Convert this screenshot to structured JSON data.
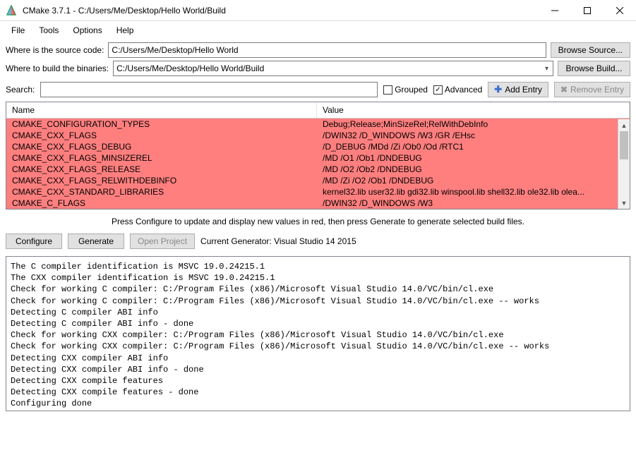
{
  "window": {
    "title": "CMake 3.7.1 - C:/Users/Me/Desktop/Hello World/Build"
  },
  "menu": {
    "file": "File",
    "tools": "Tools",
    "options": "Options",
    "help": "Help"
  },
  "paths": {
    "source_label": "Where is the source code:",
    "source_value": "C:/Users/Me/Desktop/Hello World",
    "browse_source": "Browse Source...",
    "build_label": "Where to build the binaries:",
    "build_value": "C:/Users/Me/Desktop/Hello World/Build",
    "browse_build": "Browse Build..."
  },
  "search": {
    "label": "Search:",
    "value": "",
    "grouped_label": "Grouped",
    "grouped_checked": false,
    "advanced_label": "Advanced",
    "advanced_checked": true,
    "add_entry": "Add Entry",
    "remove_entry": "Remove Entry"
  },
  "table": {
    "col_name": "Name",
    "col_value": "Value",
    "rows": [
      {
        "name": "CMAKE_CONFIGURATION_TYPES",
        "value": "Debug;Release;MinSizeRel;RelWithDebInfo"
      },
      {
        "name": "CMAKE_CXX_FLAGS",
        "value": "/DWIN32 /D_WINDOWS /W3 /GR /EHsc"
      },
      {
        "name": "CMAKE_CXX_FLAGS_DEBUG",
        "value": "/D_DEBUG /MDd /Zi /Ob0 /Od /RTC1"
      },
      {
        "name": "CMAKE_CXX_FLAGS_MINSIZEREL",
        "value": "/MD /O1 /Ob1 /DNDEBUG"
      },
      {
        "name": "CMAKE_CXX_FLAGS_RELEASE",
        "value": "/MD /O2 /Ob2 /DNDEBUG"
      },
      {
        "name": "CMAKE_CXX_FLAGS_RELWITHDEBINFO",
        "value": "/MD /Zi /O2 /Ob1 /DNDEBUG"
      },
      {
        "name": "CMAKE_CXX_STANDARD_LIBRARIES",
        "value": "kernel32.lib user32.lib gdi32.lib winspool.lib shell32.lib ole32.lib olea..."
      },
      {
        "name": "CMAKE_C_FLAGS",
        "value": "/DWIN32 /D_WINDOWS /W3"
      }
    ]
  },
  "hint": "Press Configure to update and display new values in red, then press Generate to generate selected build files.",
  "buttons": {
    "configure": "Configure",
    "generate": "Generate",
    "open_project": "Open Project",
    "generator": "Current Generator: Visual Studio 14 2015"
  },
  "output_lines": [
    "The C compiler identification is MSVC 19.0.24215.1",
    "The CXX compiler identification is MSVC 19.0.24215.1",
    "Check for working C compiler: C:/Program Files (x86)/Microsoft Visual Studio 14.0/VC/bin/cl.exe",
    "Check for working C compiler: C:/Program Files (x86)/Microsoft Visual Studio 14.0/VC/bin/cl.exe -- works",
    "Detecting C compiler ABI info",
    "Detecting C compiler ABI info - done",
    "Check for working CXX compiler: C:/Program Files (x86)/Microsoft Visual Studio 14.0/VC/bin/cl.exe",
    "Check for working CXX compiler: C:/Program Files (x86)/Microsoft Visual Studio 14.0/VC/bin/cl.exe -- works",
    "Detecting CXX compiler ABI info",
    "Detecting CXX compiler ABI info - done",
    "Detecting CXX compile features",
    "Detecting CXX compile features - done",
    "Configuring done"
  ]
}
